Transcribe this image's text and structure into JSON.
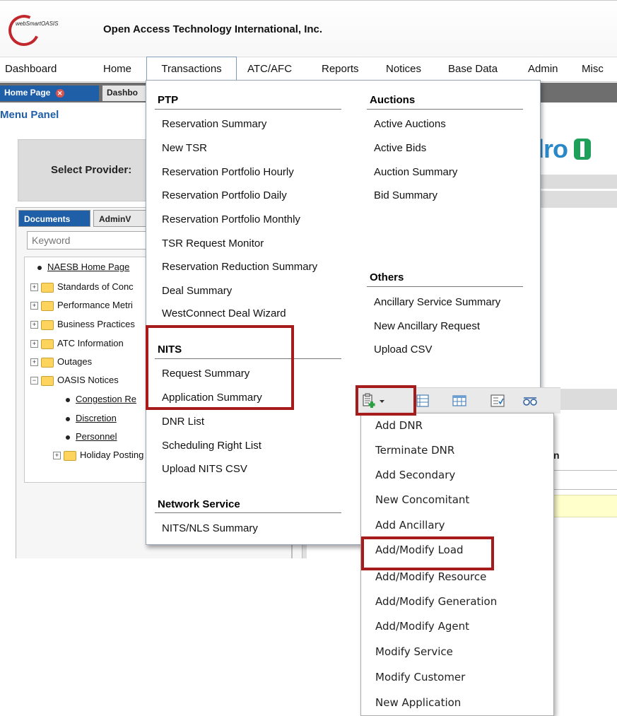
{
  "header": {
    "logo_text": "webSmartOASIS",
    "company": "Open Access Technology International, Inc."
  },
  "menubar": {
    "items": [
      "Dashboard",
      "Home",
      "Transactions",
      "ATC/AFC",
      "Reports",
      "Notices",
      "Base Data",
      "Admin",
      "Misc"
    ]
  },
  "tabs": {
    "home": "Home Page",
    "dashboard": "Dashbo"
  },
  "menu_panel": {
    "title": "Menu Panel",
    "select_provider": "Select Provider:",
    "brand_fragment": "dro"
  },
  "left_tabs": {
    "documents": "Documents",
    "admin": "AdminV"
  },
  "search": {
    "placeholder": "Keyword"
  },
  "tree": {
    "items": [
      "NAESB Home Page",
      "Standards of Conc",
      "Performance Metri",
      "Business Practices",
      "ATC Information",
      "Outages",
      "OASIS Notices",
      "Congestion Re",
      "Discretion",
      "Personnel",
      "Holiday Posting"
    ]
  },
  "megamenu": {
    "ptp": {
      "heading": "PTP",
      "items": [
        "Reservation Summary",
        "New TSR",
        "Reservation Portfolio Hourly",
        "Reservation Portfolio Daily",
        "Reservation Portfolio Monthly",
        "TSR Request Monitor",
        "Reservation Reduction Summary",
        "Deal Summary",
        "WestConnect Deal Wizard"
      ]
    },
    "nits": {
      "heading": "NITS",
      "items": [
        "Request Summary",
        "Application Summary",
        "DNR List",
        "Scheduling Right List",
        "Upload NITS CSV"
      ]
    },
    "network": {
      "heading": "Network Service",
      "items": [
        "NITS/NLS Summary"
      ]
    },
    "auctions": {
      "heading": "Auctions",
      "items": [
        "Active Auctions",
        "Active Bids",
        "Auction Summary",
        "Bid Summary"
      ]
    },
    "others": {
      "heading": "Others",
      "items": [
        "Ancillary Service Summary",
        "New Ancillary Request",
        "Upload CSV"
      ]
    }
  },
  "right_fragment": {
    "header": "n"
  },
  "dropdown": {
    "items": [
      "Add DNR",
      "Terminate DNR",
      "Add Secondary",
      "New Concomitant",
      "Add Ancillary",
      "Add/Modify Load",
      "Add/Modify Resource",
      "Add/Modify Generation",
      "Add/Modify Agent",
      "Modify Service",
      "Modify Customer",
      "New Application"
    ]
  },
  "colors": {
    "accent_blue": "#1f5fa8",
    "highlight_red": "#a61c1c",
    "tab_gray": "#6e6e6e"
  }
}
